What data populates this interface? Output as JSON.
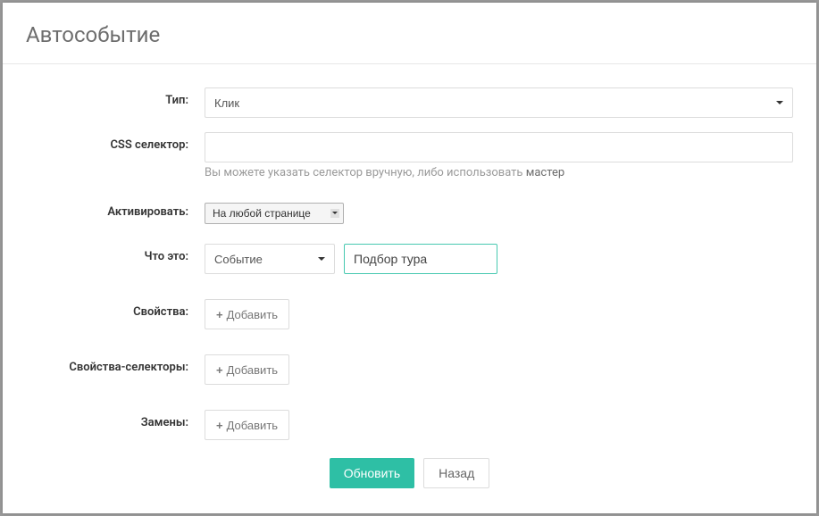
{
  "modal": {
    "title": "Автособытие"
  },
  "labels": {
    "type": "Тип:",
    "css_selector": "CSS селектор:",
    "activate": "Активировать:",
    "what_is": "Что это:",
    "properties": "Свойства:",
    "selector_properties": "Свойства-селекторы:",
    "replacements": "Замены:"
  },
  "fields": {
    "type_value": "Клик",
    "css_selector_value": "",
    "helper_text_prefix": "Вы можете указать селектор вручную, либо использовать ",
    "helper_link": "мастер",
    "activate_value": "На любой странице",
    "what_is_kind": "Событие",
    "what_is_name": "Подбор тура"
  },
  "buttons": {
    "add": "Добавить",
    "update": "Обновить",
    "back": "Назад"
  }
}
